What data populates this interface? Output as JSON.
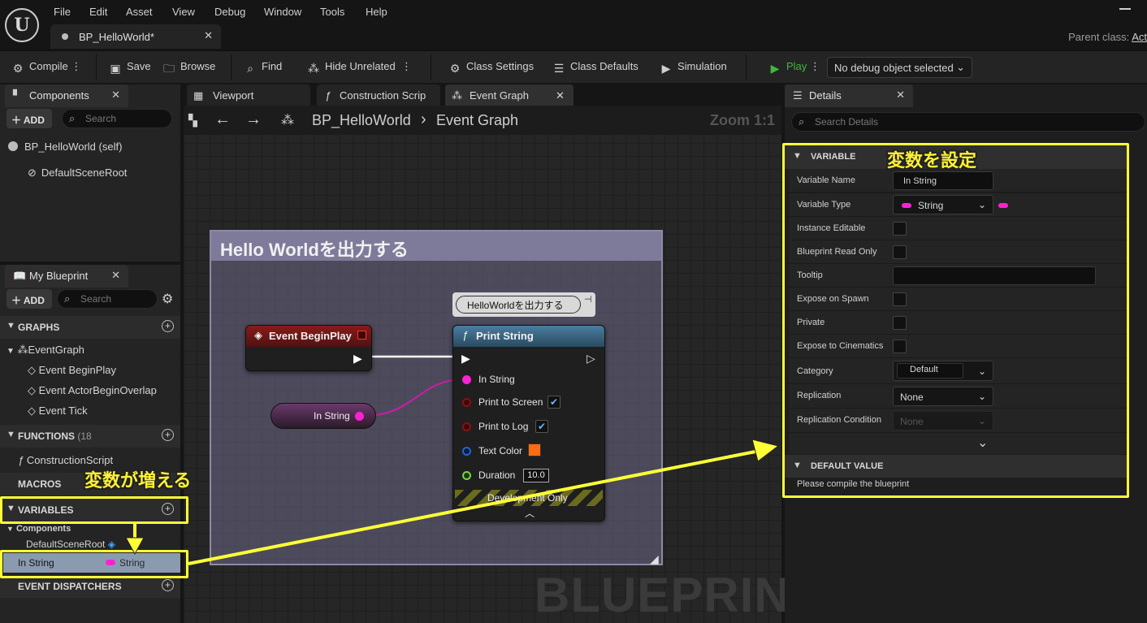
{
  "menu": [
    "File",
    "Edit",
    "Asset",
    "View",
    "Debug",
    "Window",
    "Tools",
    "Help"
  ],
  "doc_tab": "BP_HelloWorld*",
  "parent_class": "Parent class:",
  "parent_class_value": "Act",
  "toolbar": {
    "compile": "Compile",
    "save": "Save",
    "browse": "Browse",
    "find": "Find",
    "hide_unrelated": "Hide Unrelated",
    "class_settings": "Class Settings",
    "class_defaults": "Class Defaults",
    "simulation": "Simulation",
    "play": "Play",
    "debug_object": "No debug object selected"
  },
  "components": {
    "tab": "Components",
    "add": "ADD",
    "search_placeholder": "Search",
    "items": [
      "BP_HelloWorld (self)",
      "DefaultSceneRoot"
    ]
  },
  "my_blueprint": {
    "tab": "My Blueprint",
    "add": "ADD",
    "search_placeholder": "Search",
    "graphs_header": "GRAPHS",
    "event_graph": "EventGraph",
    "events": [
      "Event BeginPlay",
      "Event ActorBeginOverlap",
      "Event Tick"
    ],
    "functions_header": "FUNCTIONS",
    "functions_count": "(18",
    "construction_script": "ConstructionScript",
    "macros_header": "MACROS",
    "variables_header": "VARIABLES",
    "components_group": "Components",
    "default_scene_root": "DefaultSceneRoot",
    "var_name": "In String",
    "var_type": "String",
    "dispatchers_header": "EVENT DISPATCHERS"
  },
  "graph_tabs": {
    "viewport": "Viewport",
    "construction": "Construction Scrip",
    "event_graph": "Event Graph"
  },
  "breadcrumb": {
    "blueprint": "BP_HelloWorld",
    "separator": "›",
    "graph": "Event Graph",
    "zoom": "Zoom 1:1"
  },
  "comment_box": "Hello Worldを出力する",
  "node_comment": "HelloWorldを出力する",
  "event_node": "Event BeginPlay",
  "var_node": "In String",
  "print_node": {
    "title": "Print String",
    "in_string": "In String",
    "print_to_screen": "Print to Screen",
    "print_to_log": "Print to Log",
    "text_color": "Text Color",
    "duration": "Duration",
    "duration_value": "10.0",
    "dev_only": "Development Only"
  },
  "watermark": "BLUEPRINT",
  "details": {
    "tab": "Details",
    "search_placeholder": "Search Details",
    "variable_header": "VARIABLE",
    "rows": {
      "variable_name": "Variable Name",
      "variable_name_value": "In String",
      "variable_type": "Variable Type",
      "variable_type_value": "String",
      "instance_editable": "Instance Editable",
      "read_only": "Blueprint Read Only",
      "tooltip": "Tooltip",
      "expose_spawn": "Expose on Spawn",
      "private": "Private",
      "expose_cinematics": "Expose to Cinematics",
      "category": "Category",
      "category_value": "Default",
      "replication": "Replication",
      "replication_value": "None",
      "replication_condition": "Replication Condition",
      "replication_condition_value": "None"
    },
    "default_value_header": "DEFAULT VALUE",
    "compile_msg": "Please compile the blueprint"
  },
  "annotations": {
    "set_variable": "変数を設定",
    "variable_added": "変数が増える"
  },
  "colors": {
    "highlight": "#ffff38",
    "string_pin": "#ff20d6",
    "event_head": "#8a1a1a",
    "function_head": "#4a7ea0",
    "play_green": "#3fb83f"
  }
}
